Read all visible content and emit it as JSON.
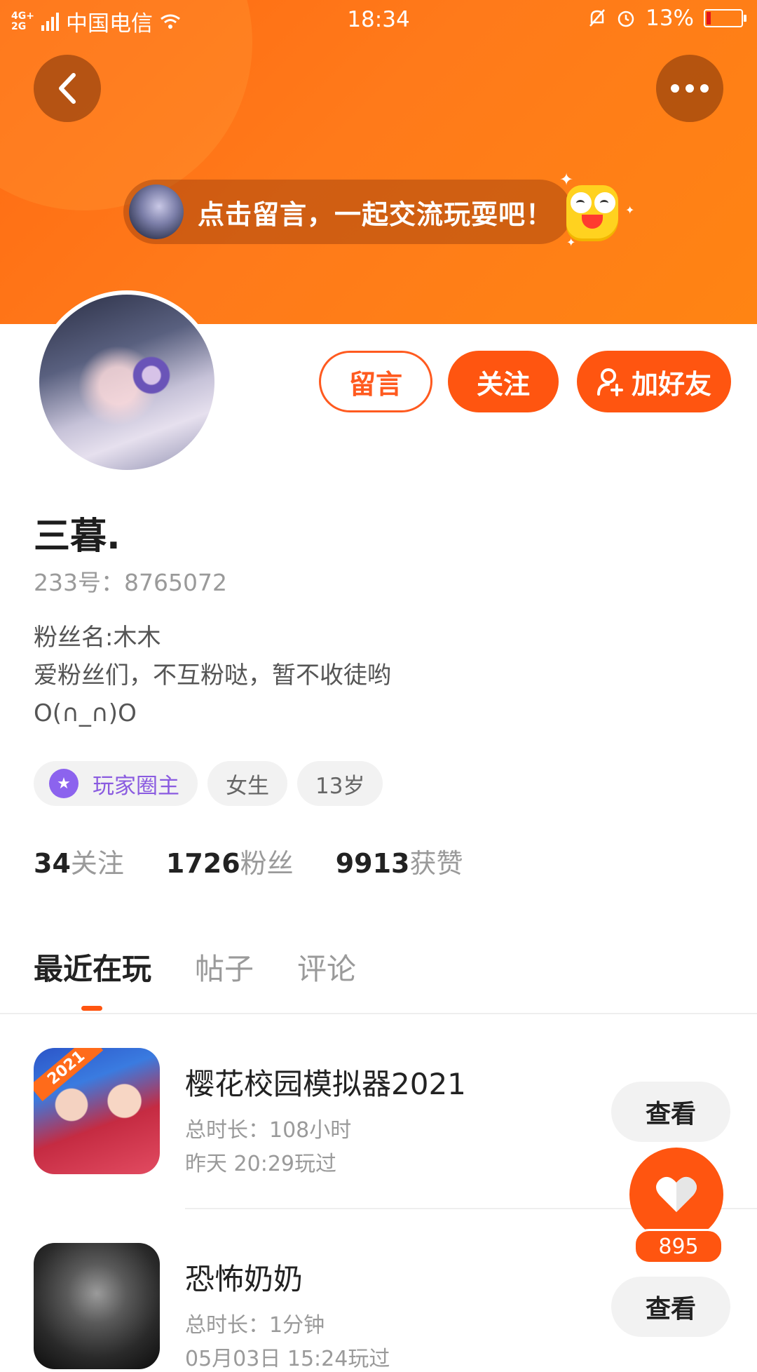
{
  "status_bar": {
    "network": "4G+ 2G",
    "carrier": "中国电信",
    "time": "18:34",
    "battery": "13%",
    "battery_level": 0.13
  },
  "header": {
    "message_prompt": "点击留言，一起交流玩耍吧！"
  },
  "actions": {
    "message_label": "留言",
    "follow_label": "关注",
    "add_friend_label": "加好友"
  },
  "profile": {
    "name": "三暮.",
    "uid": "233号：8765072",
    "bio": [
      "粉丝名:木木",
      "爱粉丝们，不互粉哒，暂不收徒哟",
      "O(∩_∩)O"
    ],
    "tags": {
      "role": "玩家圈主",
      "gender": "女生",
      "age": "13岁"
    },
    "stats": {
      "following_num": "34",
      "following_label": "关注",
      "fans_num": "1726",
      "fans_label": "粉丝",
      "likes_num": "9913",
      "likes_label": "获赞"
    }
  },
  "tabs": [
    "最近在玩",
    "帖子",
    "评论"
  ],
  "games": [
    {
      "title": "樱花校园模拟器2021",
      "duration": "总时长：108小时",
      "last_played": "昨天 20:29玩过",
      "icon_badge": "2021",
      "view_label": "查看"
    },
    {
      "title": "恐怖奶奶",
      "duration": "总时长：1分钟",
      "last_played": "05月03日 15:24玩过",
      "view_label": "查看"
    }
  ],
  "like_fab": {
    "count": "895"
  },
  "colors": {
    "accent": "#ff5510",
    "header_start": "#ff6a12",
    "role_purple": "#8c63ee"
  }
}
